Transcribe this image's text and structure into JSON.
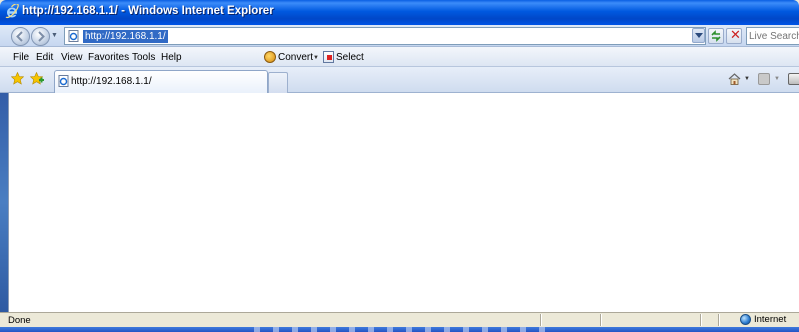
{
  "window": {
    "title": "http://192.168.1.1/ - Windows Internet Explorer"
  },
  "address_bar": {
    "url": "http://192.168.1.1/"
  },
  "search": {
    "placeholder": "Live Search"
  },
  "menu": {
    "items": [
      "File",
      "Edit",
      "View",
      "Favorites",
      "Tools",
      "Help"
    ]
  },
  "toolbar": {
    "convert_label": "Convert",
    "select_label": "Select"
  },
  "tabs": [
    {
      "label": "http://192.168.1.1/",
      "active": true
    }
  ],
  "status": {
    "text": "Done",
    "zone": "Internet"
  },
  "colors": {
    "title_bar": "#0054e6",
    "address_selection": "#316ac5",
    "chrome": "#ece9d8"
  }
}
